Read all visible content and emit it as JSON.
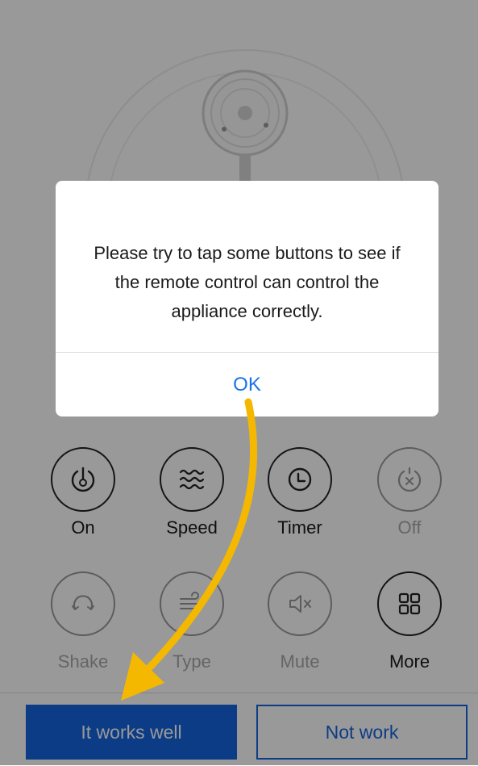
{
  "dialog": {
    "message": "Please try to tap some buttons to see if the remote control can control the appliance correctly.",
    "ok_label": "OK"
  },
  "controls": [
    {
      "label": "On",
      "icon": "power-icon",
      "enabled": true
    },
    {
      "label": "Speed",
      "icon": "wind-speed-icon",
      "enabled": true
    },
    {
      "label": "Timer",
      "icon": "timer-icon",
      "enabled": true
    },
    {
      "label": "Off",
      "icon": "power-off-icon",
      "enabled": false
    },
    {
      "label": "Shake",
      "icon": "oscillate-icon",
      "enabled": false
    },
    {
      "label": "Type",
      "icon": "wind-type-icon",
      "enabled": false
    },
    {
      "label": "Mute",
      "icon": "mute-icon",
      "enabled": false
    },
    {
      "label": "More",
      "icon": "grid-icon",
      "enabled": true
    }
  ],
  "bottom_bar": {
    "works_label": "It works well",
    "not_work_label": "Not work"
  },
  "colors": {
    "accent_blue": "#1565e0",
    "annotation_arrow": "#f5b800",
    "overlay": "rgba(0,0,0,0.40)"
  }
}
